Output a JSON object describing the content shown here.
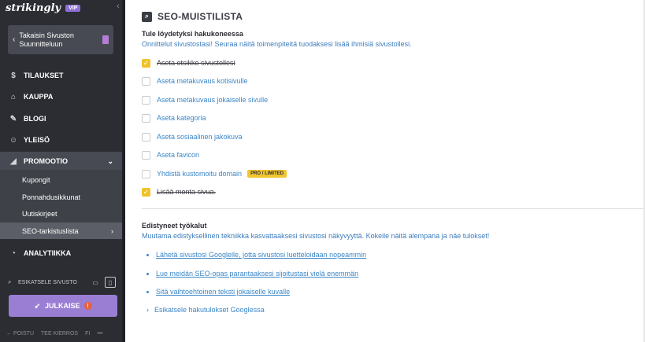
{
  "brand": {
    "name": "strikingly",
    "badge": "VIP"
  },
  "back_button": {
    "label": "Takaisin Sivuston Suunnitteluun"
  },
  "nav": {
    "orders": "TILAUKSET",
    "store": "KAUPPA",
    "blog": "BLOGI",
    "audience": "YLEISÖ",
    "promotion": "PROMOOTIO",
    "analytics": "ANALYTIIKKA"
  },
  "promo_sub": {
    "coupons": "Kupongit",
    "popups": "Ponnahdusikkunat",
    "newsletters": "Uutiskirjeet",
    "seo": "SEO-tarkistuslista"
  },
  "preview": {
    "label": "ESIKATSELE SIVUSTO"
  },
  "publish": {
    "label": "JULKAISE",
    "badge": "!"
  },
  "footer": {
    "exit": "← POISTU",
    "tour": "TEE KIERROS",
    "lang": "FI",
    "more": "•••"
  },
  "page": {
    "title": "SEO-MUISTILISTA",
    "heading": "Tule löydetyksi hakukoneessa",
    "subtitle": "Onnittelut sivustostasi! Seuraa näitä toimenpiteitä tuodaksesi lisää ihmisiä sivustollesi.",
    "checklist": [
      {
        "label": "Aseta otsikko sivustollesi",
        "done": true
      },
      {
        "label": "Aseta metakuvaus kotisivulle",
        "done": false
      },
      {
        "label": "Aseta metakuvaus jokaiselle sivulle",
        "done": false
      },
      {
        "label": "Aseta kategoria",
        "done": false
      },
      {
        "label": "Aseta sosiaalinen jakokuva",
        "done": false
      },
      {
        "label": "Aseta favicon",
        "done": false
      },
      {
        "label": "Yhdistä kustomoitu domain",
        "done": false,
        "badge": "PRO / LIMITED"
      },
      {
        "label": "Lisää monta sivua.",
        "done": true
      }
    ],
    "advanced_heading": "Edistyneet työkalut",
    "advanced_subtitle": "Muutama edistyksellinen tekniikka kasvattaaksesi sivustosi näkyvyyttä. Kokeile näitä alempana ja näe tulokset!",
    "links": [
      "Lähetä sivustosi Googlelle, jotta sivustosi luetteloidaan nopeammin",
      "Lue meidän SEO-opas parantaaksesi sijoitustasi vielä enemmän",
      "Sitä vaihtoehtoinen teksti jokaiselle kuvalle"
    ],
    "preview_link": "Esikatsele hakutulokset Googlessa"
  },
  "colors": {
    "sidebar": "#2b2d33",
    "accent": "#9a7ed3",
    "check": "#f0c229",
    "link": "#3c87c7"
  }
}
